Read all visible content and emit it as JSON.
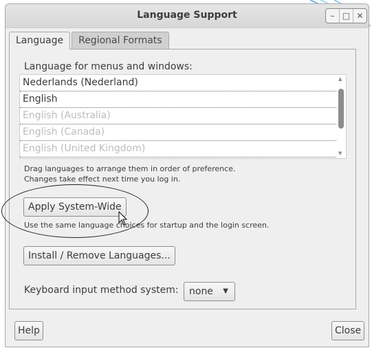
{
  "window": {
    "title": "Language Support"
  },
  "tabs": [
    {
      "label": "Language"
    },
    {
      "label": "Regional Formats"
    }
  ],
  "language": {
    "heading": "Language for menus and windows:",
    "list": [
      "Nederlands (Nederland)",
      "English",
      "English (Australia)",
      "English (Canada)",
      "English (United Kingdom)"
    ],
    "hint_line1": "Drag languages to arrange them in order of preference.",
    "hint_line2": "Changes take effect next time you log in.",
    "apply_button": "Apply System-Wide",
    "apply_hint": "Use the same language choices for startup and the login screen.",
    "install_button": "Install / Remove Languages...",
    "keyboard_label": "Keyboard input method system:",
    "keyboard_value": "none"
  },
  "footer": {
    "help_button": "Help",
    "close_button": "Close"
  },
  "icons": {
    "minimize": "minimize-icon",
    "maximize": "maximize-icon",
    "close": "close-icon",
    "dropdown": "chevron-down-icon",
    "cursor": "mouse-cursor-icon"
  }
}
